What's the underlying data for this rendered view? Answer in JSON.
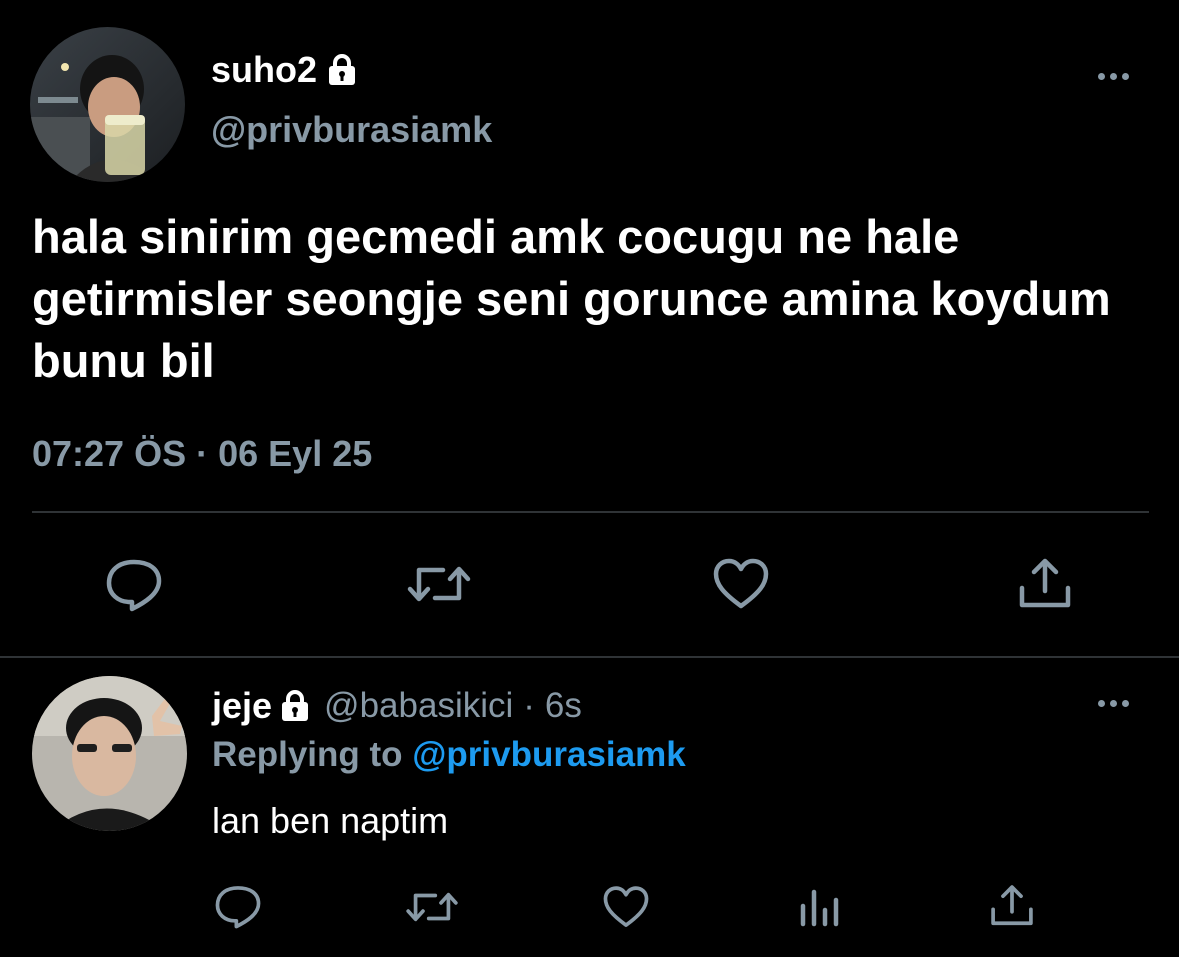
{
  "main_tweet": {
    "display_name": "suho2",
    "handle": "@privburasiamk",
    "text": "hala sinirim gecmedi amk cocugu ne hale getirmisler seongje seni gorunce amina koydum bunu bil",
    "time": "07:27 ÖS",
    "separator": "·",
    "date": "06 Eyl 25",
    "actions": [
      "reply-icon",
      "retweet-icon",
      "like-icon",
      "share-icon"
    ]
  },
  "reply_tweet": {
    "display_name": "jeje",
    "handle": "@babasikici",
    "separator": "·",
    "age": "6s",
    "replying_prefix": "Replying to",
    "replying_handle": "@privburasiamk",
    "text": "lan ben naptim",
    "actions": [
      "reply-icon",
      "retweet-icon",
      "like-icon",
      "analytics-icon",
      "share-icon"
    ]
  },
  "colors": {
    "background": "#000000",
    "text": "#ffffff",
    "secondary": "#8899a6",
    "link": "#1d9bf0",
    "divider": "#2f3336"
  }
}
